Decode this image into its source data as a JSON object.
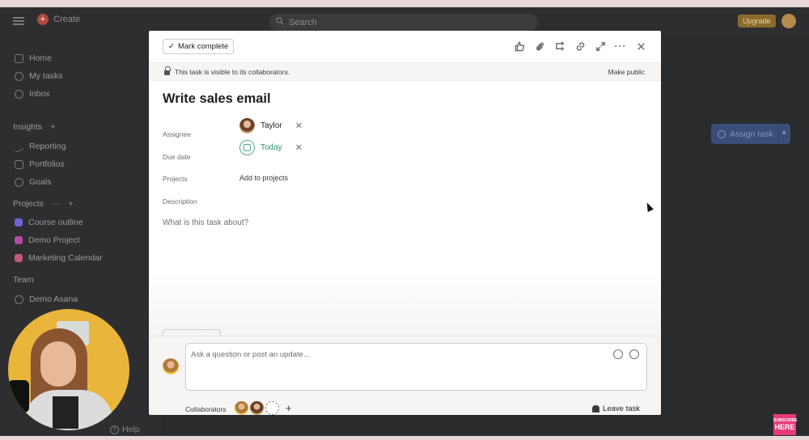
{
  "topbar": {
    "create_label": "Create",
    "search_placeholder": "Search",
    "upgrade_label": "Upgrade"
  },
  "sidebar": {
    "nav": [
      {
        "label": "Home"
      },
      {
        "label": "My tasks"
      },
      {
        "label": "Inbox"
      }
    ],
    "insights_label": "Insights",
    "insights_items": [
      {
        "label": "Reporting"
      },
      {
        "label": "Portfolios"
      },
      {
        "label": "Goals"
      }
    ],
    "projects_label": "Projects",
    "projects": [
      {
        "label": "Course outline",
        "color": "#6b63d6"
      },
      {
        "label": "Demo Project",
        "color": "#b04aa6"
      },
      {
        "label": "Marketing Calendar",
        "color": "#c2577a"
      }
    ],
    "team_label": "Team",
    "team_items": [
      {
        "label": "Demo Asana"
      }
    ],
    "help_label": "Help"
  },
  "background": {
    "assign_task_label": "Assign task"
  },
  "modal": {
    "mark_complete_label": "Mark complete",
    "visibility_text": "This task is visible to its collaborators.",
    "make_public_label": "Make public",
    "title": "Write sales email",
    "fields": {
      "assignee_label": "Assignee",
      "assignee_name": "Taylor",
      "due_date_label": "Due date",
      "due_date_value": "Today",
      "projects_label": "Projects",
      "add_to_projects": "Add to projects",
      "description_label": "Description",
      "description_placeholder": "What is this task about?"
    },
    "comment": {
      "placeholder": "Ask a question or post an update...",
      "collaborators_label": "Collaborators",
      "leave_task_label": "Leave task"
    }
  },
  "subscribe_badge": {
    "line1": "SUBSCRIBE",
    "line2": "HERE"
  },
  "colors": {
    "accent_green": "#2e8f6a",
    "upgrade_bg": "#8b6a2b",
    "assign_bg": "#3a4e7a"
  }
}
